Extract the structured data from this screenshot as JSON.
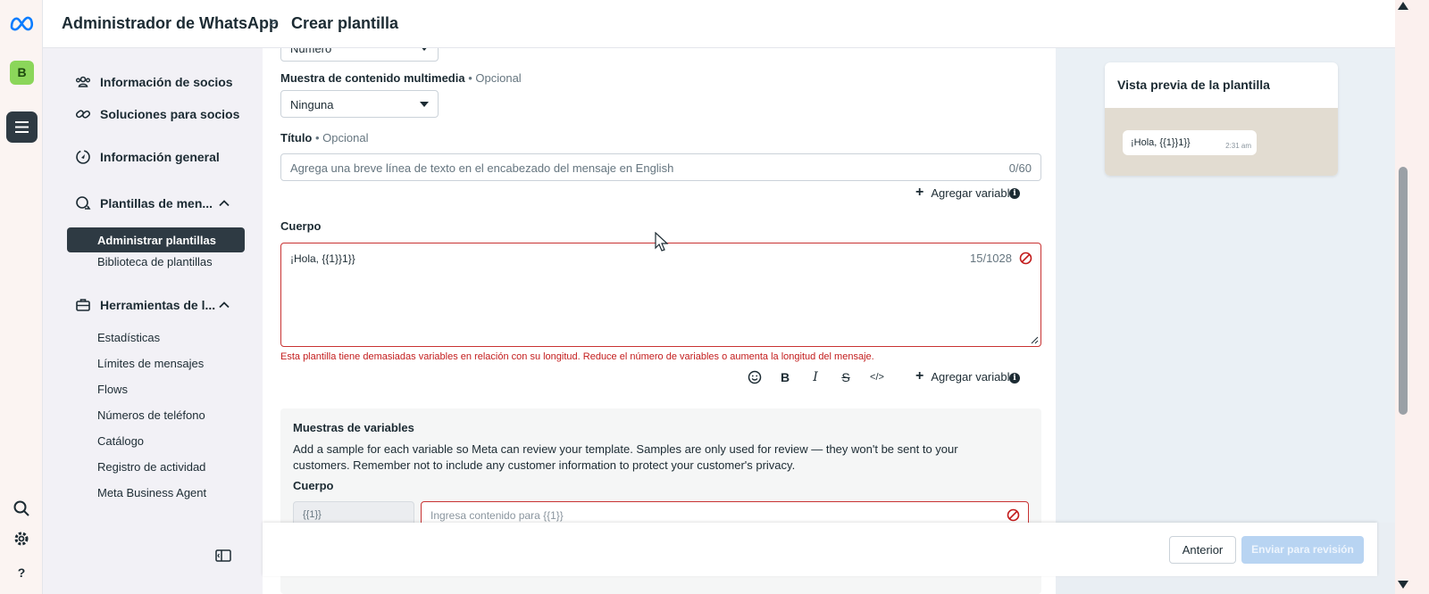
{
  "header": {
    "app_title": "Administrador de WhatsApp",
    "separator": ">",
    "page_title": "Crear plantilla"
  },
  "rail": {
    "business_initial": "B",
    "help_label": "?"
  },
  "sidebar": {
    "items": [
      {
        "label": "Información de socios",
        "icon": "partners-icon"
      },
      {
        "label": "Soluciones para socios",
        "icon": "link-icon"
      },
      {
        "label": "Información general",
        "icon": "overview-icon"
      },
      {
        "label": "Plantillas de men...",
        "icon": "templates-icon"
      },
      {
        "label": "Herramientas de l...",
        "icon": "toolbox-icon"
      }
    ],
    "template_subitems": [
      {
        "label": "Administrar plantillas",
        "active": true
      },
      {
        "label": "Biblioteca de plantillas"
      }
    ],
    "tool_subitems": [
      "Estadísticas",
      "Límites de mensajes",
      "Flows",
      "Números de teléfono",
      "Catálogo",
      "Registro de actividad",
      "Meta Business Agent"
    ]
  },
  "form": {
    "variable_type_value": "Número",
    "media_label": "Muestra de contenido multimedia",
    "optional": "• Opcional",
    "media_value": "Ninguna",
    "title_label": "Título",
    "title_placeholder": "Agrega una breve línea de texto en el encabezado del mensaje en English",
    "title_count": "0/60",
    "add_variable": "Agregar variable",
    "body_label": "Cuerpo",
    "body_value": "¡Hola, {{1}}1}}",
    "body_count": "15/1028",
    "body_error": "Esta plantilla tiene demasiadas variables en relación con su longitud. Reduce el número de variables o aumenta la longitud del mensaje.",
    "samples": {
      "heading": "Muestras de variables",
      "description": "Add a sample for each variable so Meta can review your template. Samples are only used for review — they won't be sent to your customers. Remember not to include any customer information to protect your customer's privacy.",
      "body_label": "Cuerpo",
      "var_name": "{{1}}",
      "input_placeholder": "Ingresa contenido para {{1}}"
    }
  },
  "footer": {
    "prev_label": "Anterior",
    "submit_label": "Enviar para revisión"
  },
  "preview": {
    "title": "Vista previa de la plantilla",
    "message": "¡Hola, {{1}}1}}",
    "time": "2:31 am"
  },
  "colors": {
    "error": "#c31d1d",
    "active_nav": "#2e3a43",
    "submit_disabled": "#b8d4f2",
    "business_badge": "#8bd65a"
  }
}
